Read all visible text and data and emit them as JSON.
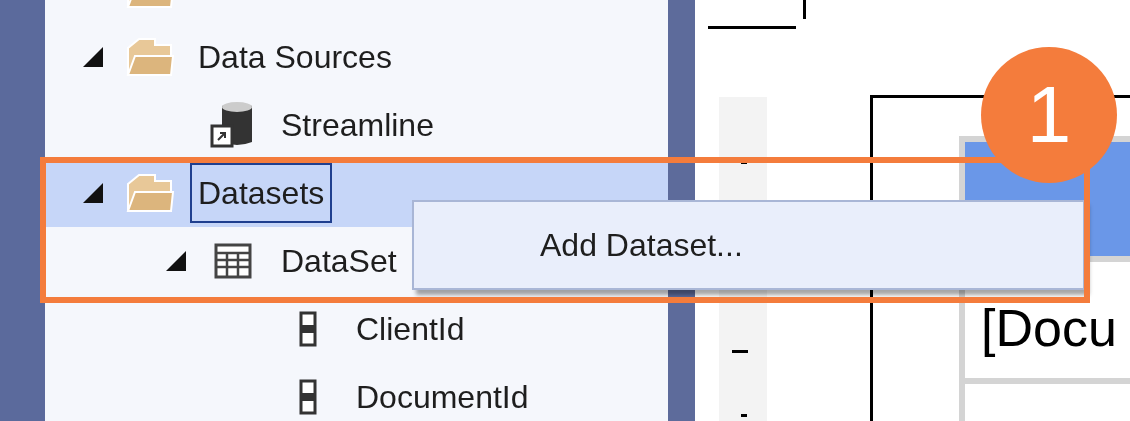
{
  "tree": {
    "items": [
      {
        "kind": "folder",
        "selected": false
      },
      {
        "label": "Data Sources",
        "kind": "folder",
        "expanded": true,
        "selected": false,
        "children": [
          {
            "label": "Streamline",
            "kind": "datasource",
            "selected": false
          }
        ]
      },
      {
        "label": "Datasets",
        "kind": "folder",
        "expanded": true,
        "selected": true,
        "children": [
          {
            "label": "DataSet",
            "kind": "dataset",
            "expanded": true,
            "selected": false,
            "children": [
              {
                "label": "ClientId",
                "kind": "field",
                "selected": false
              },
              {
                "label": "DocumentId",
                "kind": "field",
                "selected": false
              }
            ]
          }
        ]
      }
    ]
  },
  "context_menu": {
    "items": [
      "Add Dataset..."
    ]
  },
  "report": {
    "table": {
      "detail": "[Docu"
    }
  },
  "annotation": {
    "badge": "1"
  }
}
